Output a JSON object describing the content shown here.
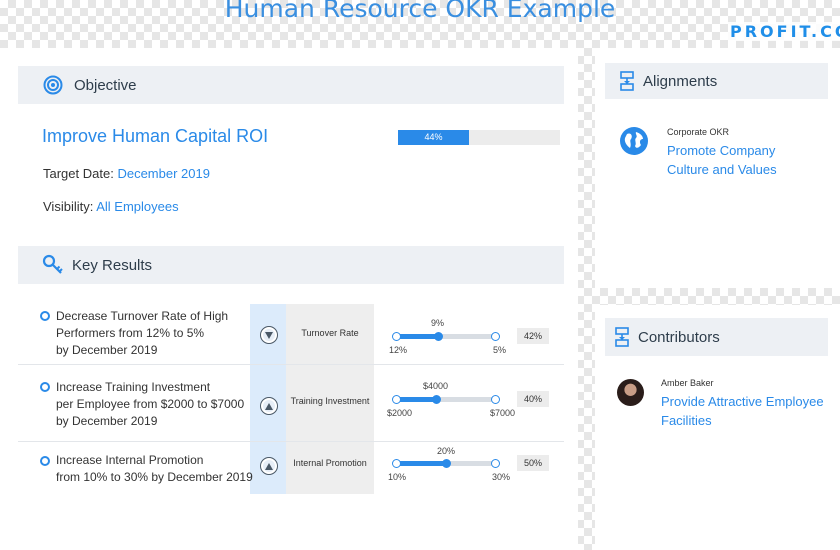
{
  "page": {
    "title": "Human Resource OKR Example",
    "brand": "PROFIT.CO"
  },
  "objective": {
    "header": "Objective",
    "title": "Improve Human Capital ROI",
    "progress_label": "44%",
    "progress": 0.44,
    "target_date_label": "Target Date:",
    "target_date": "December 2019",
    "visibility_label": "Visibility:",
    "visibility": "All Employees"
  },
  "key_results": {
    "header": "Key Results",
    "items": [
      {
        "lines": [
          "Decrease Turnover Rate of High",
          "Performers from 12% to 5%",
          "by December 2019"
        ],
        "direction": "down",
        "metric": "Turnover Rate",
        "current": "9%",
        "start": "12%",
        "target": "5%",
        "progress_value": 0.42,
        "progress_label": "42%"
      },
      {
        "lines": [
          "Increase Training Investment",
          "per Employee from $2000 to $7000",
          "by December 2019"
        ],
        "direction": "up",
        "metric": "Training Investment",
        "current": "$4000",
        "start": "$2000",
        "target": "$7000",
        "progress_value": 0.4,
        "progress_label": "40%"
      },
      {
        "lines": [
          "Increase Internal Promotion",
          "from 10% to 30% by December 2019"
        ],
        "direction": "up",
        "metric": "Internal Promotion",
        "current": "20%",
        "start": "10%",
        "target": "30%",
        "progress_value": 0.5,
        "progress_label": "50%"
      }
    ]
  },
  "alignments": {
    "header": "Alignments",
    "caption": "Corporate OKR",
    "link_lines": [
      "Promote Company",
      "Culture and Values"
    ]
  },
  "contributors": {
    "header": "Contributors",
    "name": "Amber Baker",
    "link_lines": [
      "Provide Attractive Employee",
      "Facilities"
    ]
  },
  "colors": {
    "accent": "#2a8ae8",
    "title": "#3a8fe0",
    "header_bg": "#edf0f4"
  },
  "icons": {
    "objective": "target-icon",
    "key_results": "key-icon",
    "alignments": "alignment-icon",
    "contributors": "contributors-icon",
    "globe": "globe-icon",
    "arrow_down": "arrow-down-icon",
    "arrow_up": "arrow-up-icon"
  }
}
